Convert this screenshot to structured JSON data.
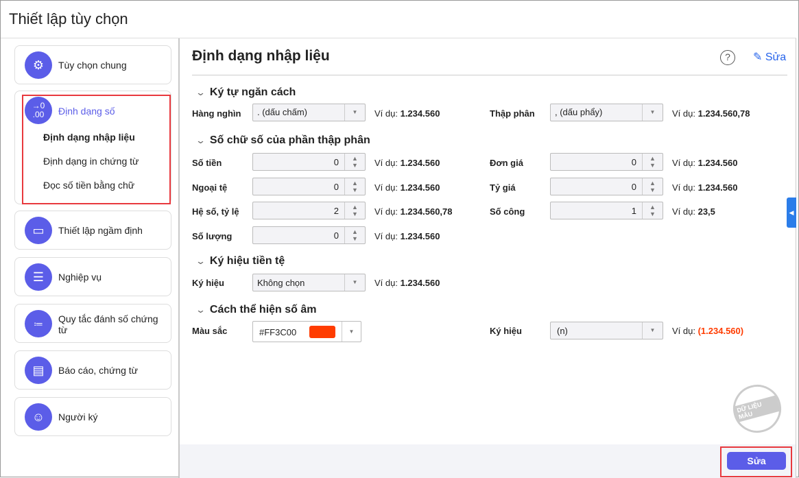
{
  "window": {
    "title": "Thiết lập tùy chọn"
  },
  "sidebar": {
    "items": [
      {
        "label": "Tùy chọn chung",
        "icon": "gear-icon"
      },
      {
        "label": "Định dạng số",
        "icon": "number-format-icon",
        "icon_text": "→0\n.00",
        "subitems": [
          "Định dạng nhập liệu",
          "Định dạng in chứng từ",
          "Đọc số tiền bằng chữ"
        ]
      },
      {
        "label": "Thiết lập ngầm định",
        "icon": "drive-icon"
      },
      {
        "label": "Nghiệp vụ",
        "icon": "server-icon"
      },
      {
        "label": "Quy tắc đánh số chứng từ",
        "icon": "numbered-list-icon"
      },
      {
        "label": "Báo cáo, chứng từ",
        "icon": "document-icon"
      },
      {
        "label": "Người ký",
        "icon": "user-icon"
      }
    ]
  },
  "main": {
    "title": "Định dạng nhập liệu",
    "edit_link": "Sửa",
    "example_label": "Ví dụ:",
    "sections": {
      "separator": {
        "title": "Ký tự ngăn cách",
        "thousands_label": "Hàng nghìn",
        "thousands_value": ". (dấu chấm)",
        "thousands_example": "1.234.560",
        "decimal_label": "Thập phân",
        "decimal_value": ", (dấu phẩy)",
        "decimal_example": "1.234.560,78"
      },
      "decimals": {
        "title": "Số chữ số của phần thập phân",
        "fields": [
          {
            "label": "Số tiền",
            "value": "0",
            "example": "1.234.560"
          },
          {
            "label": "Ngoại tệ",
            "value": "0",
            "example": "1.234.560"
          },
          {
            "label": "Hệ số, tỷ lệ",
            "value": "2",
            "example": "1.234.560,78"
          },
          {
            "label": "Số lượng",
            "value": "0",
            "example": "1.234.560"
          },
          {
            "label": "Đơn giá",
            "value": "0",
            "example": "1.234.560"
          },
          {
            "label": "Tỷ giá",
            "value": "0",
            "example": "1.234.560"
          },
          {
            "label": "Số công",
            "value": "1",
            "example": "23,5"
          }
        ]
      },
      "currency": {
        "title": "Ký hiệu tiền tệ",
        "label": "Ký hiệu",
        "value": "Không chọn",
        "example": "1.234.560"
      },
      "negative": {
        "title": "Cách thể hiện số âm",
        "color_label": "Màu sắc",
        "color_value": "#FF3C00",
        "symbol_label": "Ký hiệu",
        "symbol_value": "(n)",
        "example": "(1.234.560)"
      }
    }
  },
  "watermark": "DỮ LIỆU MẪU",
  "footer": {
    "save_label": "Sửa"
  },
  "colors": {
    "accent": "#5b5de8",
    "negative": "#FF3C00",
    "link": "#2563eb"
  }
}
